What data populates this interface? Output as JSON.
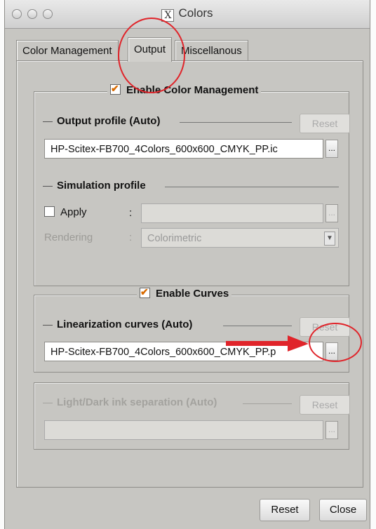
{
  "window": {
    "title": "Colors"
  },
  "tabs": [
    {
      "label": "Color Management"
    },
    {
      "label": "Output"
    },
    {
      "label": "Miscellanous"
    }
  ],
  "color_management": {
    "enable_label": "Enable Color Management",
    "enabled": true,
    "output_profile": {
      "label": "Output profile (Auto)",
      "reset_label": "Reset",
      "value": "HP-Scitex-FB700_4Colors_600x600_CMYK_PP.ic",
      "browse_label": "..."
    },
    "simulation_profile": {
      "label": "Simulation profile",
      "apply_label": "Apply",
      "apply_checked": false,
      "apply_colon": ":",
      "value": "",
      "browse_label": "...",
      "rendering_label": "Rendering",
      "rendering_colon": ":",
      "rendering_value": "Colorimetric",
      "dropdown_glyph": "▼"
    }
  },
  "curves": {
    "enable_label": "Enable Curves",
    "enabled": true,
    "linearization": {
      "label": "Linearization curves (Auto)",
      "reset_label": "Reset",
      "value": "HP-Scitex-FB700_4Colors_600x600_CMYK_PP.p",
      "browse_label": "..."
    }
  },
  "ink_separation": {
    "label": "Light/Dark ink separation (Auto)",
    "reset_label": "Reset",
    "value": "",
    "browse_label": "..."
  },
  "footer": {
    "reset_label": "Reset",
    "close_label": "Close"
  },
  "annotation_color": "#e0242a"
}
